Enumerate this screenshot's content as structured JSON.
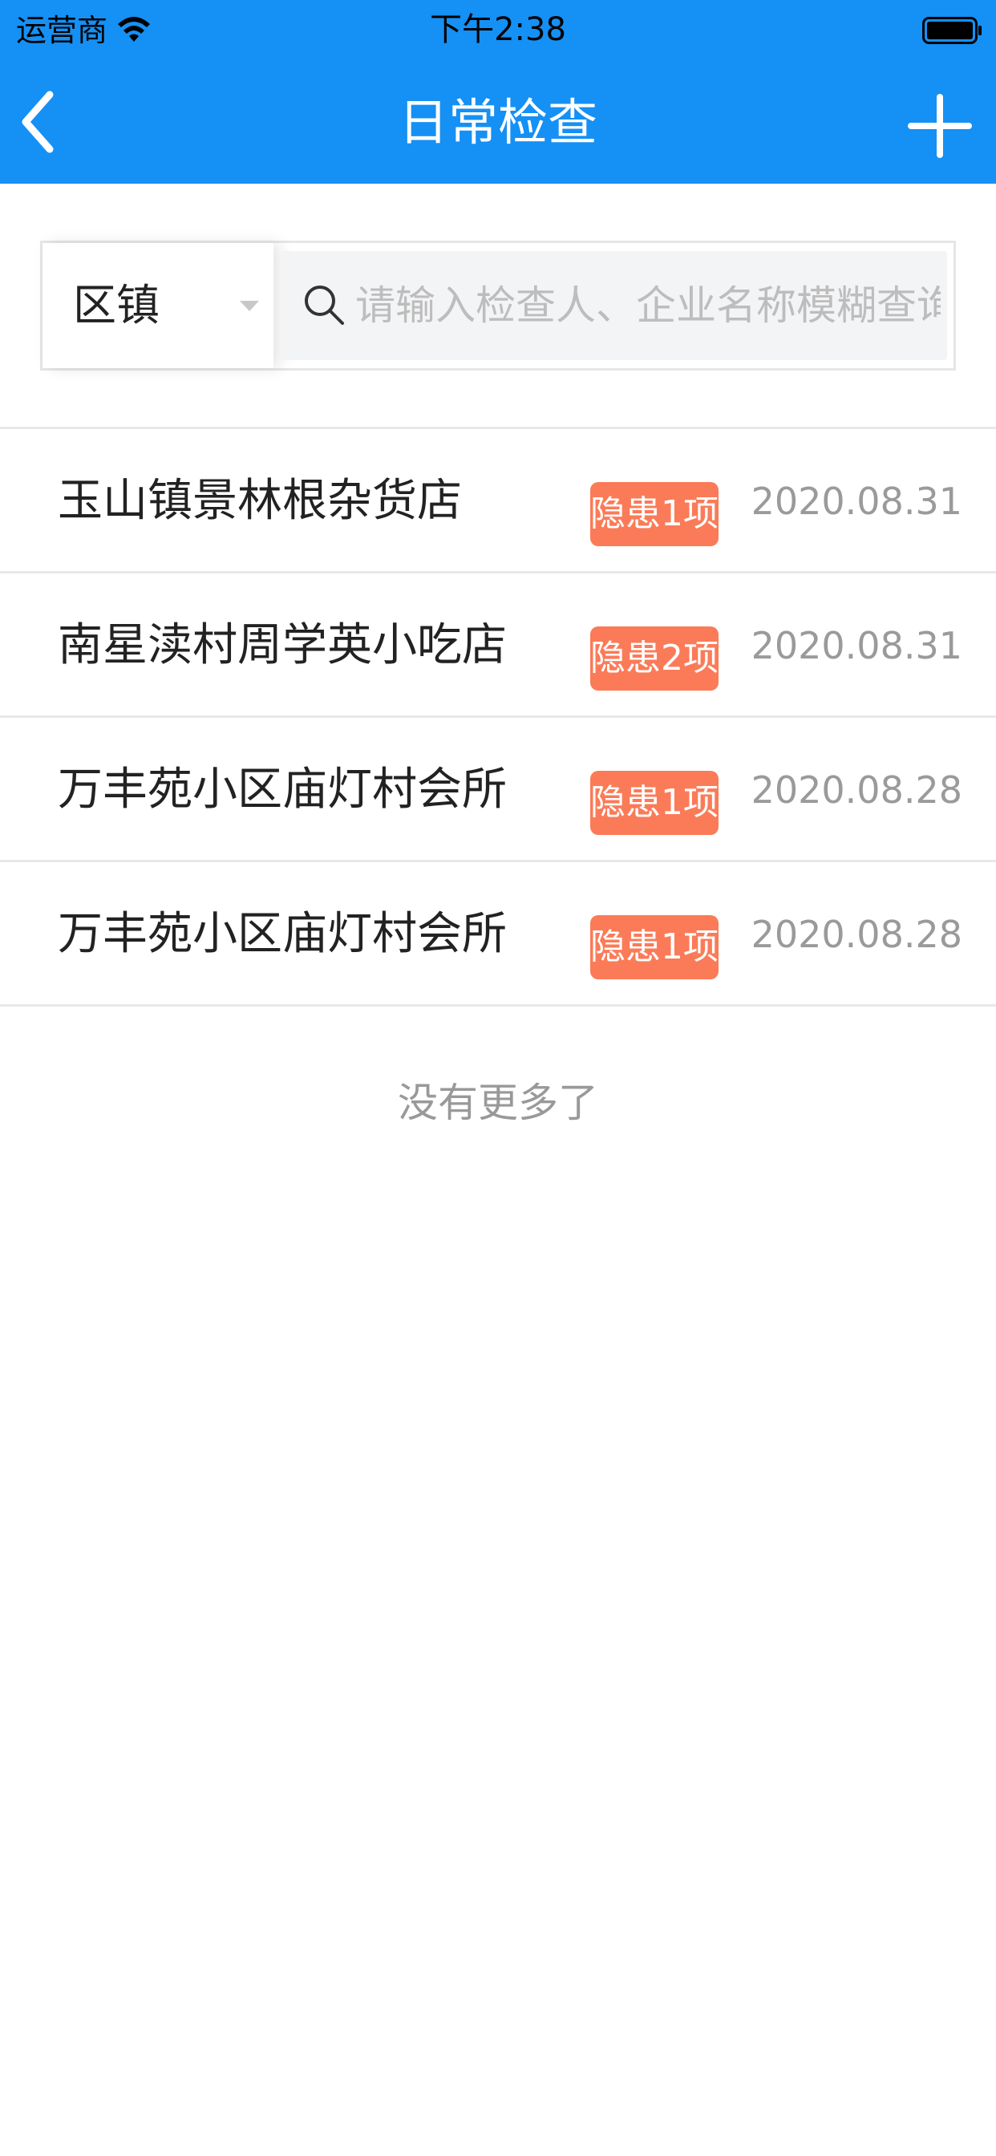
{
  "status_bar": {
    "carrier": "运营商",
    "time": "下午2:38"
  },
  "nav": {
    "title": "日常检查",
    "back_icon": "chevron-left-icon",
    "add_icon": "plus-icon"
  },
  "filter": {
    "district_label": "区镇",
    "search_placeholder": "请输入检查人、企业名称模糊查询",
    "search_value": ""
  },
  "list": {
    "items": [
      {
        "name": "玉山镇景林根杂货店",
        "badge": "隐患1项",
        "date": "2020.08.31"
      },
      {
        "name": "南星渎村周学英小吃店",
        "badge": "隐患2项",
        "date": "2020.08.31"
      },
      {
        "name": "万丰苑小区庙灯村会所",
        "badge": "隐患1项",
        "date": "2020.08.28"
      },
      {
        "name": "万丰苑小区庙灯村会所",
        "badge": "隐患1项",
        "date": "2020.08.28"
      }
    ],
    "footer": "没有更多了"
  },
  "colors": {
    "header_bg": "#1590f5",
    "badge_bg": "#fb7b58",
    "date_text": "#9a9a9a"
  }
}
